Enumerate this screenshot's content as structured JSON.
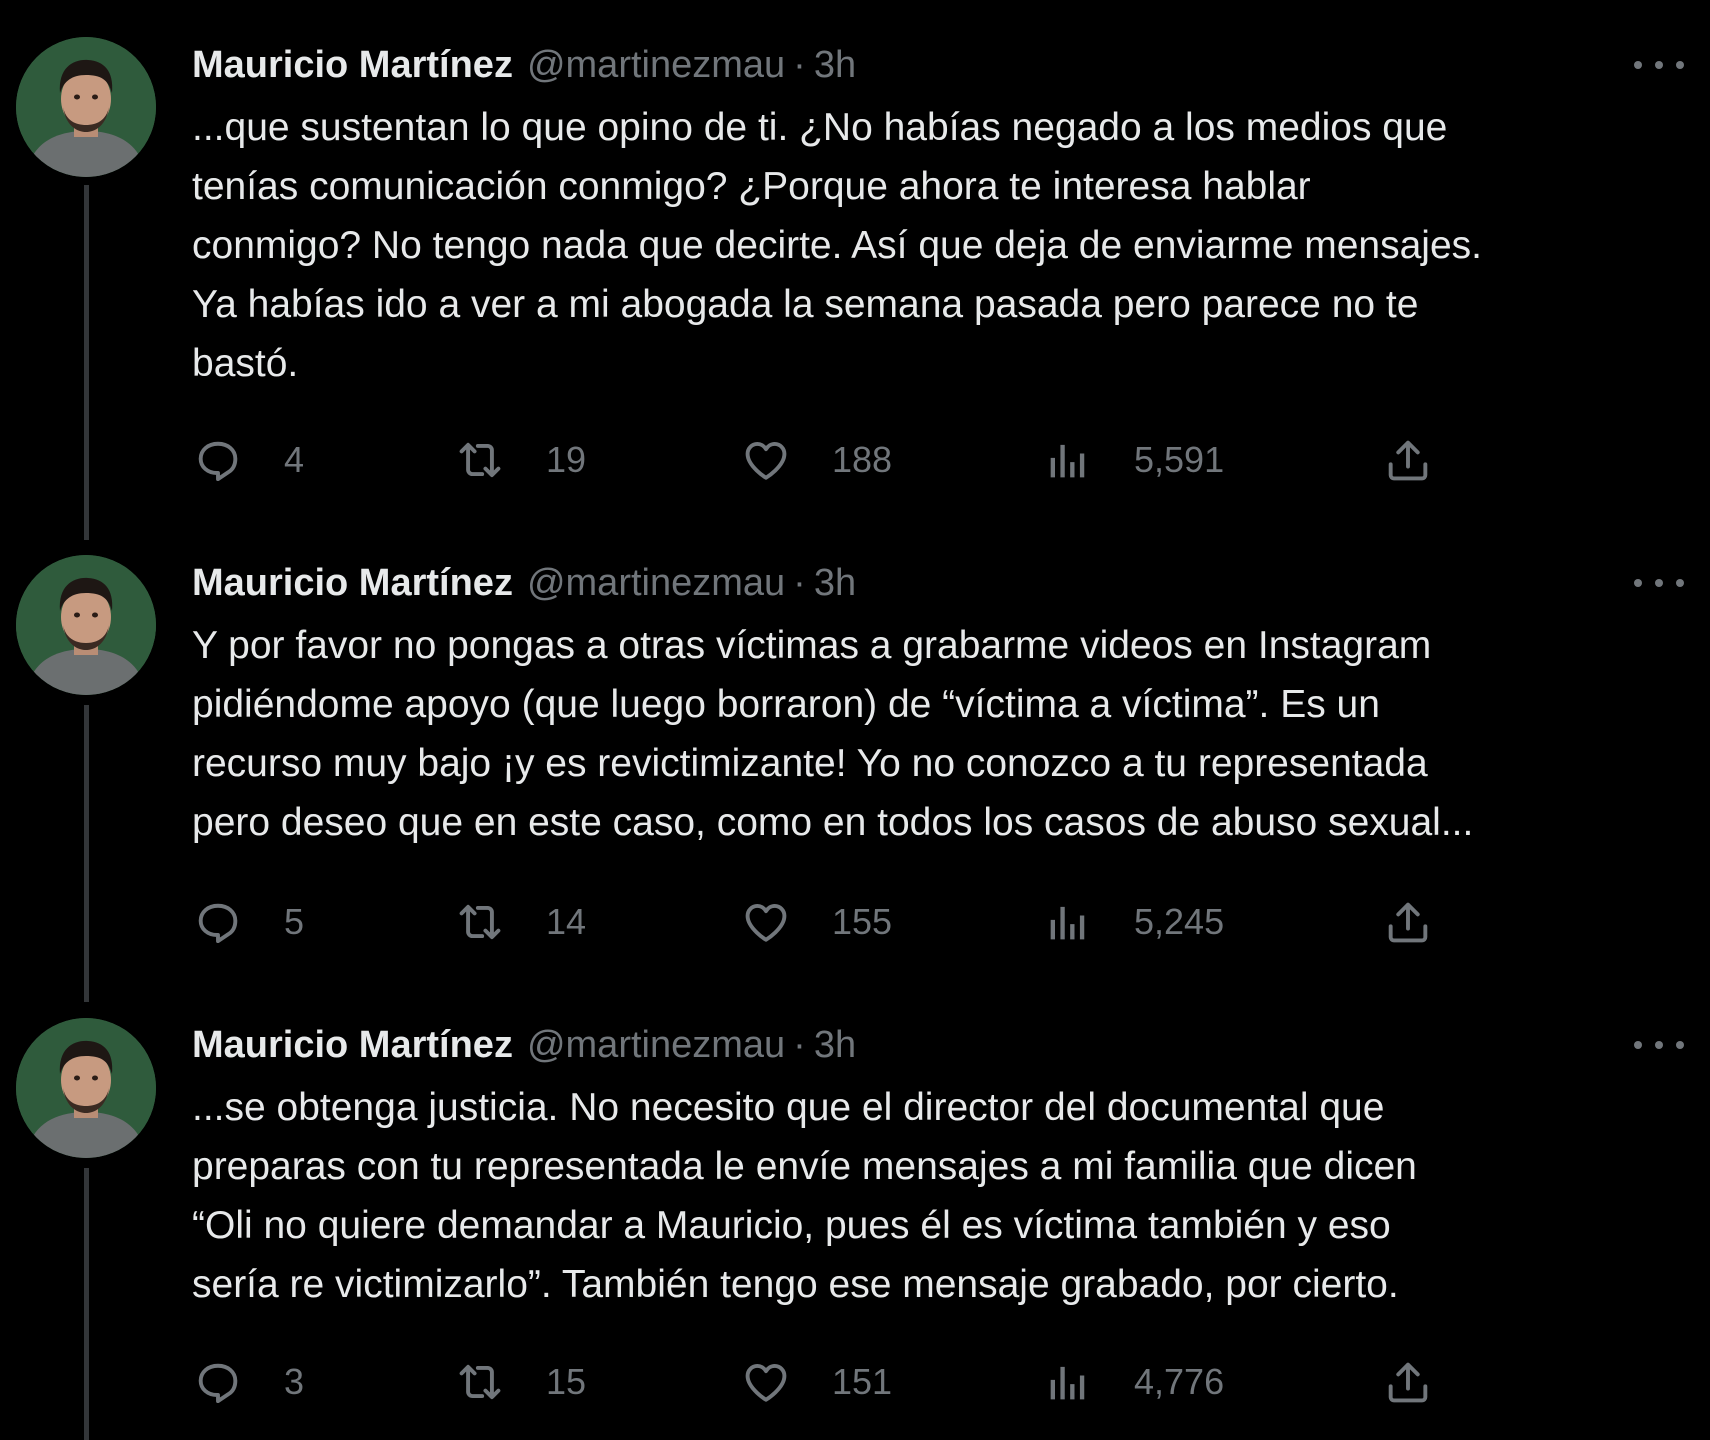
{
  "colors": {
    "background": "#000000",
    "text_primary": "#e7e9ea",
    "text_secondary": "#71767b",
    "thread_line": "#333639",
    "avatar_background": "#2f5b3c"
  },
  "icons": {
    "reply": "reply-icon",
    "retweet": "retweet-icon",
    "like": "heart-icon",
    "views": "views-icon",
    "share": "share-icon",
    "more": "more-icon"
  },
  "tweets": [
    {
      "author": {
        "name": "Mauricio Martínez",
        "handle": "@martinezmau",
        "separator": "·",
        "time": "3h"
      },
      "text": "...que sustentan lo que opino de ti. ¿No habías negado a los medios que\ntenías comunicación conmigo? ¿Porque ahora te interesa hablar\nconmigo? No tengo nada que decirte. Así que deja de enviarme mensajes.\nYa habías ido a ver a mi abogada la semana pasada pero parece no te\nbastó.",
      "stats": {
        "replies": "4",
        "retweets": "19",
        "likes": "188",
        "views": "5,591"
      }
    },
    {
      "author": {
        "name": "Mauricio Martínez",
        "handle": "@martinezmau",
        "separator": "·",
        "time": "3h"
      },
      "text": "Y por favor no pongas a otras víctimas a grabarme videos en Instagram\npidiéndome apoyo (que luego borraron) de “víctima a víctima”. Es un\nrecurso muy bajo ¡y es revictimizante! Yo no conozco a tu representada\npero deseo que en este caso, como en todos los casos de abuso sexual...",
      "stats": {
        "replies": "5",
        "retweets": "14",
        "likes": "155",
        "views": "5,245"
      }
    },
    {
      "author": {
        "name": "Mauricio Martínez",
        "handle": "@martinezmau",
        "separator": "·",
        "time": "3h"
      },
      "text": "...se obtenga justicia. No necesito que el director del documental que\npreparas con tu representada le envíe mensajes a mi familia que dicen\n“Oli no quiere demandar a Mauricio, pues él es víctima también y eso\nsería re victimizarlo”. También tengo ese mensaje grabado, por cierto.",
      "stats": {
        "replies": "3",
        "retweets": "15",
        "likes": "151",
        "views": "4,776"
      }
    }
  ]
}
